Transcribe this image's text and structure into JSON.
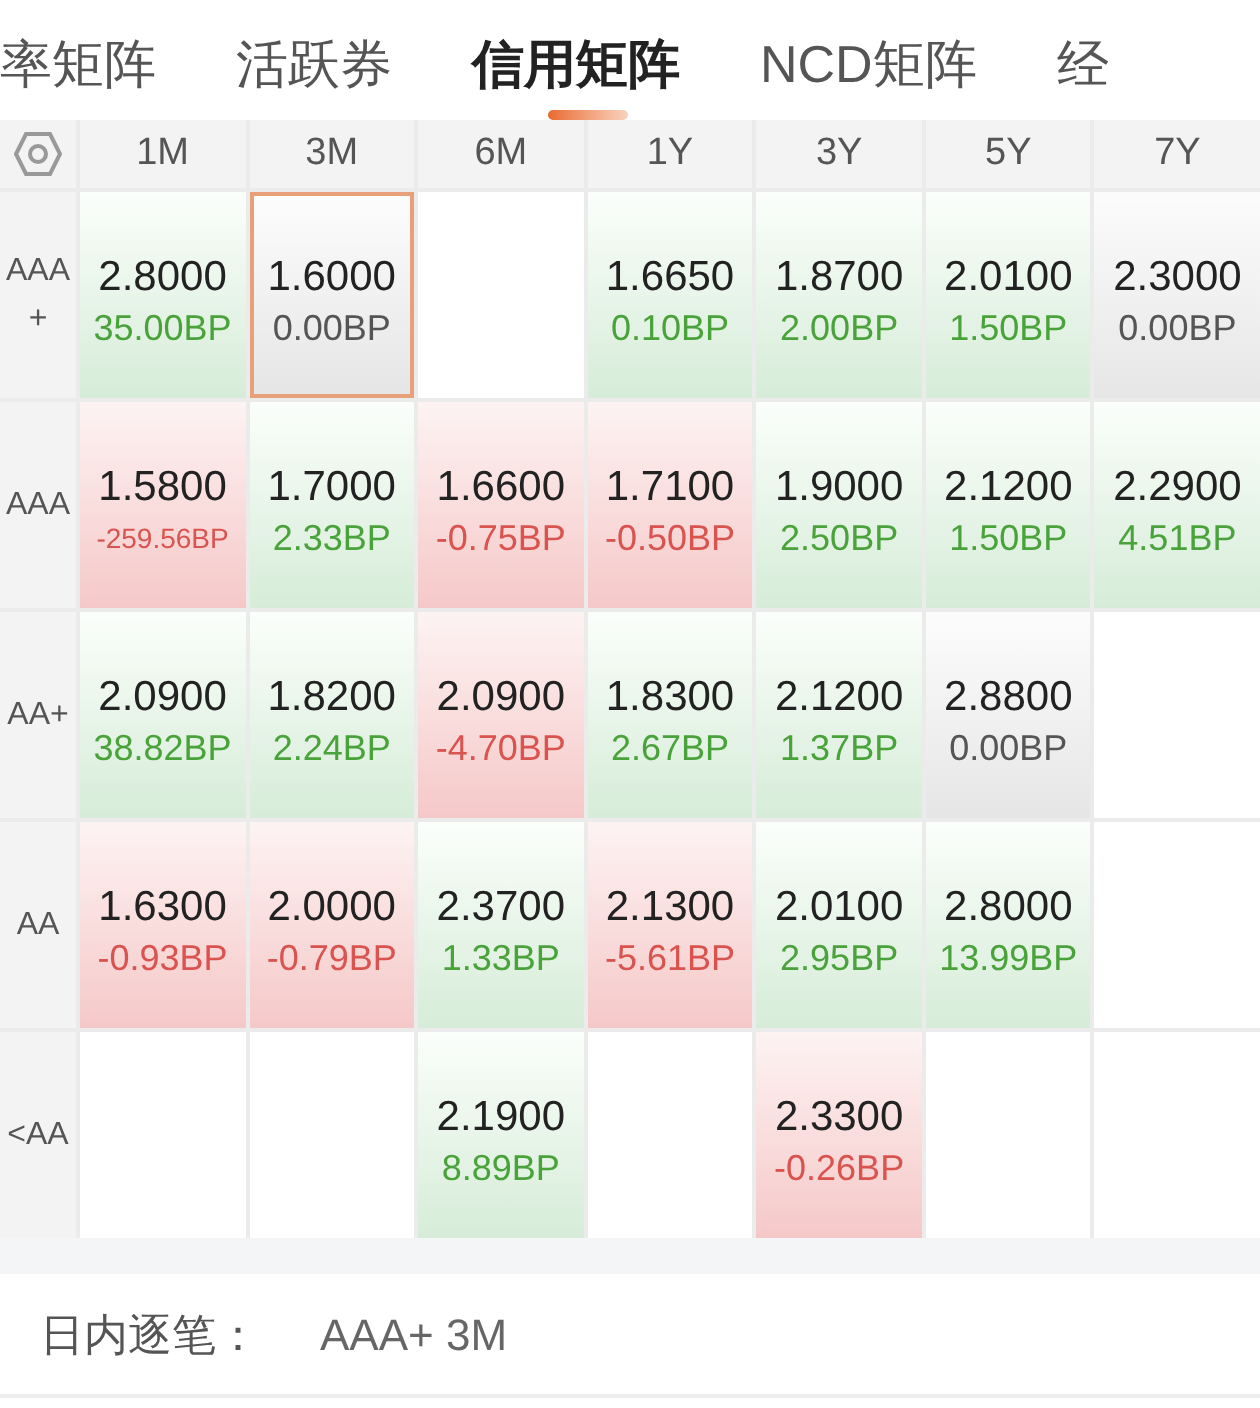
{
  "tabs": [
    {
      "label": "率矩阵",
      "selected": false
    },
    {
      "label": "活跃券",
      "selected": false
    },
    {
      "label": "信用矩阵",
      "selected": true
    },
    {
      "label": "NCD矩阵",
      "selected": false
    },
    {
      "label": "经",
      "selected": false
    }
  ],
  "matrix": {
    "columns": [
      "1M",
      "3M",
      "6M",
      "1Y",
      "3Y",
      "5Y",
      "7Y"
    ],
    "rows": [
      {
        "label": "AAA+",
        "cells": [
          {
            "yield": "2.8000",
            "change": "35.00BP",
            "kind": "up",
            "selected": false
          },
          {
            "yield": "1.6000",
            "change": "0.00BP",
            "kind": "flat",
            "selected": true
          },
          null,
          {
            "yield": "1.6650",
            "change": "0.10BP",
            "kind": "up",
            "selected": false
          },
          {
            "yield": "1.8700",
            "change": "2.00BP",
            "kind": "up",
            "selected": false
          },
          {
            "yield": "2.0100",
            "change": "1.50BP",
            "kind": "up",
            "selected": false
          },
          {
            "yield": "2.3000",
            "change": "0.00BP",
            "kind": "flat",
            "selected": false
          }
        ]
      },
      {
        "label": "AAA",
        "cells": [
          {
            "yield": "1.5800",
            "change": "-259.56BP",
            "kind": "down",
            "selected": false
          },
          {
            "yield": "1.7000",
            "change": "2.33BP",
            "kind": "up",
            "selected": false
          },
          {
            "yield": "1.6600",
            "change": "-0.75BP",
            "kind": "down",
            "selected": false
          },
          {
            "yield": "1.7100",
            "change": "-0.50BP",
            "kind": "down",
            "selected": false
          },
          {
            "yield": "1.9000",
            "change": "2.50BP",
            "kind": "up",
            "selected": false
          },
          {
            "yield": "2.1200",
            "change": "1.50BP",
            "kind": "up",
            "selected": false
          },
          {
            "yield": "2.2900",
            "change": "4.51BP",
            "kind": "up",
            "selected": false
          }
        ]
      },
      {
        "label": "AA+",
        "cells": [
          {
            "yield": "2.0900",
            "change": "38.82BP",
            "kind": "up",
            "selected": false
          },
          {
            "yield": "1.8200",
            "change": "2.24BP",
            "kind": "up",
            "selected": false
          },
          {
            "yield": "2.0900",
            "change": "-4.70BP",
            "kind": "down",
            "selected": false
          },
          {
            "yield": "1.8300",
            "change": "2.67BP",
            "kind": "up",
            "selected": false
          },
          {
            "yield": "2.1200",
            "change": "1.37BP",
            "kind": "up",
            "selected": false
          },
          {
            "yield": "2.8800",
            "change": "0.00BP",
            "kind": "flat",
            "selected": false
          },
          null
        ]
      },
      {
        "label": "AA",
        "cells": [
          {
            "yield": "1.6300",
            "change": "-0.93BP",
            "kind": "down",
            "selected": false
          },
          {
            "yield": "2.0000",
            "change": "-0.79BP",
            "kind": "down",
            "selected": false
          },
          {
            "yield": "2.3700",
            "change": "1.33BP",
            "kind": "up",
            "selected": false
          },
          {
            "yield": "2.1300",
            "change": "-5.61BP",
            "kind": "down",
            "selected": false
          },
          {
            "yield": "2.0100",
            "change": "2.95BP",
            "kind": "up",
            "selected": false
          },
          {
            "yield": "2.8000",
            "change": "13.99BP",
            "kind": "up",
            "selected": false
          },
          null
        ]
      },
      {
        "label": "<AA",
        "cells": [
          null,
          null,
          {
            "yield": "2.1900",
            "change": "8.89BP",
            "kind": "up",
            "selected": false
          },
          null,
          {
            "yield": "2.3300",
            "change": "-0.26BP",
            "kind": "down",
            "selected": false
          },
          null,
          null
        ]
      }
    ]
  },
  "footer": {
    "label": "日内逐笔：",
    "value": "AAA+ 3M"
  }
}
